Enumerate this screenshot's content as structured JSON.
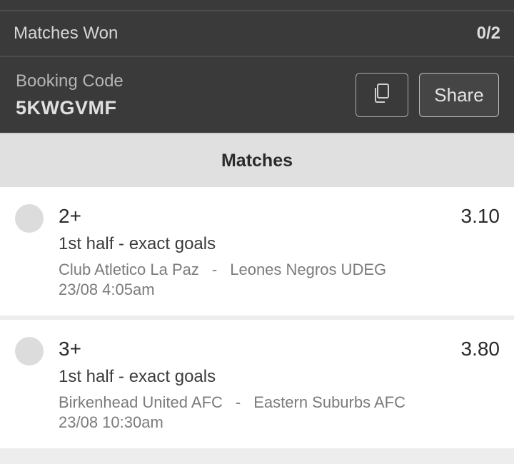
{
  "summary": {
    "matches_won_label": "Matches Won",
    "matches_won_value": "0/2"
  },
  "booking": {
    "label": "Booking Code",
    "code": "5KWGVMF",
    "copy_icon": "copy-icon",
    "share_label": "Share"
  },
  "matches_header": "Matches",
  "matches": [
    {
      "pick": "2+",
      "odds": "3.10",
      "market": "1st half - exact goals",
      "home": "Club Atletico La Paz",
      "separator": "-",
      "away": "Leones Negros UDEG",
      "kickoff": "23/08 4:05am"
    },
    {
      "pick": "3+",
      "odds": "3.80",
      "market": "1st half - exact goals",
      "home": "Birkenhead United AFC",
      "separator": "-",
      "away": "Eastern Suburbs AFC",
      "kickoff": "23/08 10:30am"
    }
  ],
  "colors": {
    "panel_bg": "#3a3a3a",
    "header_bg": "#e0e0e0",
    "card_bg": "#ffffff",
    "status_pending": "#dcdcdc"
  }
}
